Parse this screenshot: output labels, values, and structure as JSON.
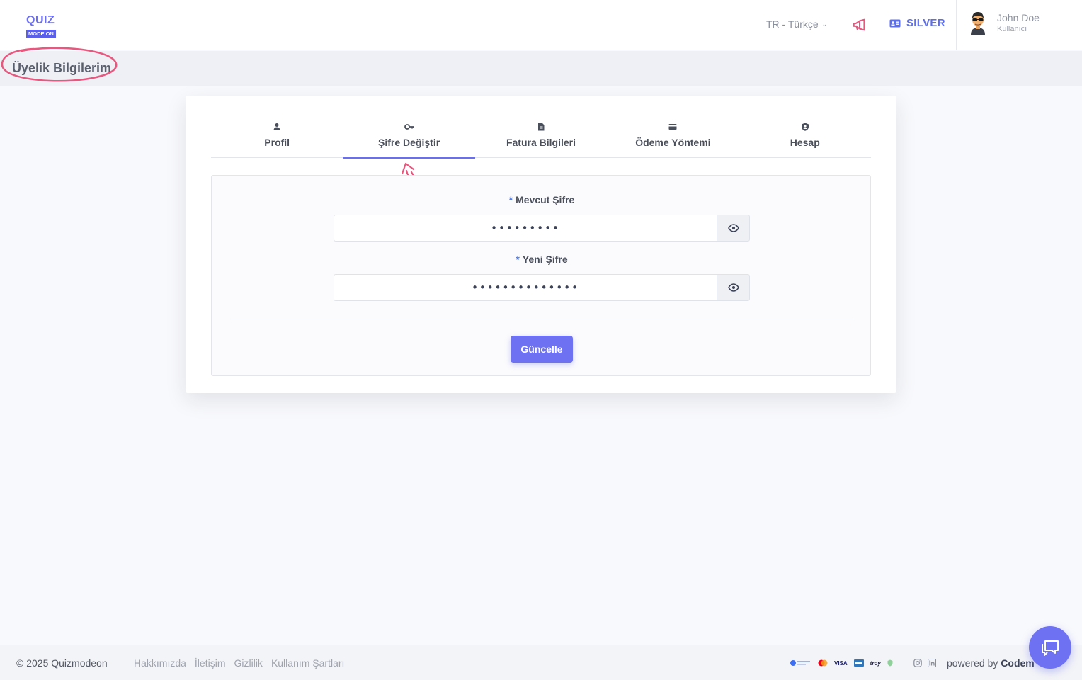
{
  "header": {
    "logo_top": "QUIZ",
    "logo_bottom": "MODE ON",
    "language": "TR - Türkçe",
    "plan": "SILVER",
    "user_name": "John Doe",
    "user_role": "Kullanıcı"
  },
  "page": {
    "title": "Üyelik Bilgilerim"
  },
  "tabs": [
    {
      "label": "Profil",
      "icon": "user-icon",
      "active": false
    },
    {
      "label": "Şifre Değiştir",
      "icon": "key-icon",
      "active": true
    },
    {
      "label": "Fatura Bilgileri",
      "icon": "document-icon",
      "active": false
    },
    {
      "label": "Ödeme Yöntemi",
      "icon": "credit-card-icon",
      "active": false
    },
    {
      "label": "Hesap",
      "icon": "shield-user-icon",
      "active": false
    }
  ],
  "form": {
    "current_password": {
      "required_mark": "*",
      "label": "Mevcut Şifre",
      "value": "•••••••••"
    },
    "new_password": {
      "required_mark": "*",
      "label": "Yeni Şifre",
      "value": "••••••••••••••"
    },
    "submit_label": "Güncelle"
  },
  "footer": {
    "copyright": "© 2025 Quizmodeon",
    "links": [
      "Hakkımızda",
      "İletişim",
      "Gizlilik",
      "Kullanım Şartları"
    ],
    "payments": {
      "visa": "VISA",
      "troy": "troy"
    },
    "powered_prefix": "powered by ",
    "powered_brand": "Codem"
  },
  "colors": {
    "accent": "#6e72f2",
    "annotation": "#e8577e",
    "plan": "#5b6ef2"
  }
}
